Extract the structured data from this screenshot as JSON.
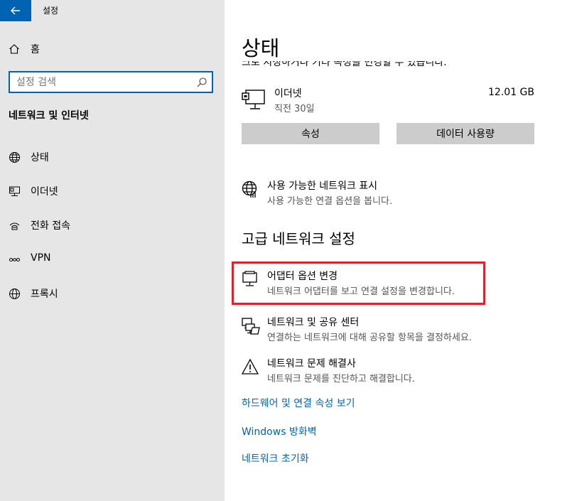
{
  "app": {
    "title": "설정"
  },
  "sidebar": {
    "home_label": "홈",
    "search": {
      "placeholder": "설정 검색"
    },
    "section_title": "네트워크 및 인터넷",
    "items": [
      {
        "label": "상태",
        "icon": "globe-status-icon"
      },
      {
        "label": "이더넷",
        "icon": "ethernet-icon"
      },
      {
        "label": "전화 접속",
        "icon": "dialup-icon"
      },
      {
        "label": "VPN",
        "icon": "vpn-icon"
      },
      {
        "label": "프록시",
        "icon": "globe-icon"
      }
    ]
  },
  "main": {
    "title": "상태",
    "clipped_desc": "크로 지정하거나 기타 속성을 변경할 수 있습니다.",
    "ethernet": {
      "name": "이더넷",
      "sub": "직전 30일",
      "size": "12.01 GB"
    },
    "buttons": {
      "properties": "속성",
      "data_usage": "데이터 사용량"
    },
    "show_networks": {
      "title": "사용 가능한 네트워크 표시",
      "sub": "사용 가능한 연결 옵션을 봅니다."
    },
    "advanced_title": "고급 네트워크 설정",
    "options": [
      {
        "title": "어댑터 옵션 변경",
        "sub": "네트워크 어댑터를 보고 연결 설정을 변경합니다."
      },
      {
        "title": "네트워크 및 공유 센터",
        "sub": "연결하는 네트워크에 대해 공유할 항목을 결정하세요."
      },
      {
        "title": "네트워크 문제 해결사",
        "sub": "네트워크 문제를 진단하고 해결합니다."
      }
    ],
    "links": [
      "하드웨어 및 연결 속성 보기",
      "Windows 방화벽",
      "네트워크 초기화"
    ]
  },
  "colors": {
    "accent": "#0063b1",
    "highlight": "#e0202b",
    "sidebar_bg": "#e6e6e6"
  }
}
